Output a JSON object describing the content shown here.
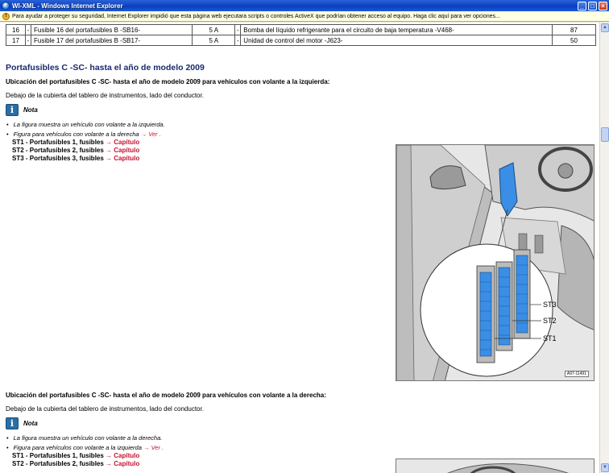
{
  "window": {
    "title": "WI-XML - Windows Internet Explorer",
    "buttons": {
      "minimize": "_",
      "maximize": "□",
      "close": "×"
    }
  },
  "infobar": {
    "text": "Para ayudar a proteger su seguridad, Internet Explorer impidió que esta página web ejecutara scripts o controles ActiveX que podrían obtener acceso al equipo. Haga clic aquí para ver opciones..."
  },
  "fuse_table": {
    "rows": [
      {
        "num": "16",
        "dash1": "-",
        "name": "Fusible 16 del portafusibles B -SB16-",
        "amp": "5 A",
        "dash2": "-",
        "desc": "Bomba del líquido refrigerante para el circuito de baja temperatura -V468-",
        "val": "87"
      },
      {
        "num": "17",
        "dash1": "-",
        "name": "Fusible 17 del portafusibles B -SB17-",
        "amp": "5 A",
        "dash2": "-",
        "desc": "Unidad de control del motor -J623-",
        "val": "50"
      }
    ]
  },
  "section": {
    "heading": "Portafusibles C -SC- hasta el año de modelo 2009",
    "left_hand": {
      "subheading": "Ubicación del portafusibles C -SC- hasta el año de modelo 2009 para vehículos con volante a la izquierda:",
      "location": "Debajo de la cubierta del tablero de instrumentos, lado del conductor.",
      "note_label": "Nota",
      "bullet1": "La figura muestra un vehículo con volante a la izquierda.",
      "bullet2_text": "Figura para vehículos con volante a la derecha",
      "bullet2_link": "→ Ver .",
      "st1_text": "ST1 - Portafusibles 1, fusibles",
      "st2_text": "ST2 - Portafusibles 2, fusibles",
      "st3_text": "ST3 - Portafusibles 3, fusibles",
      "link": "→ Capítulo"
    },
    "right_hand": {
      "subheading": "Ubicación del portafusibles C -SC- hasta el año de modelo 2009 para vehículos con volante a la derecha:",
      "location": "Debajo de la cubierta del tablero de instrumentos, lado del conductor.",
      "note_label": "Nota",
      "bullet1": "La figura muestra un vehículo con volante a la derecha.",
      "bullet2_text": "Figura para vehículos con volante a la izquierda",
      "bullet2_link": "→ Ver .",
      "st1_text": "ST1 - Portafusibles 1, fusibles",
      "st2_text": "ST2 - Portafusibles 2, fusibles",
      "link": "→ Capítulo"
    },
    "figure": {
      "labels": {
        "st3": "ST3",
        "st2": "ST2",
        "st1": "ST1"
      },
      "code": "A97-11491"
    }
  },
  "colors": {
    "heading": "#1b2a6b",
    "link": "#c8102e",
    "note_icon": "#2a6ea6",
    "fuse_blue": "#3a8ee6"
  }
}
